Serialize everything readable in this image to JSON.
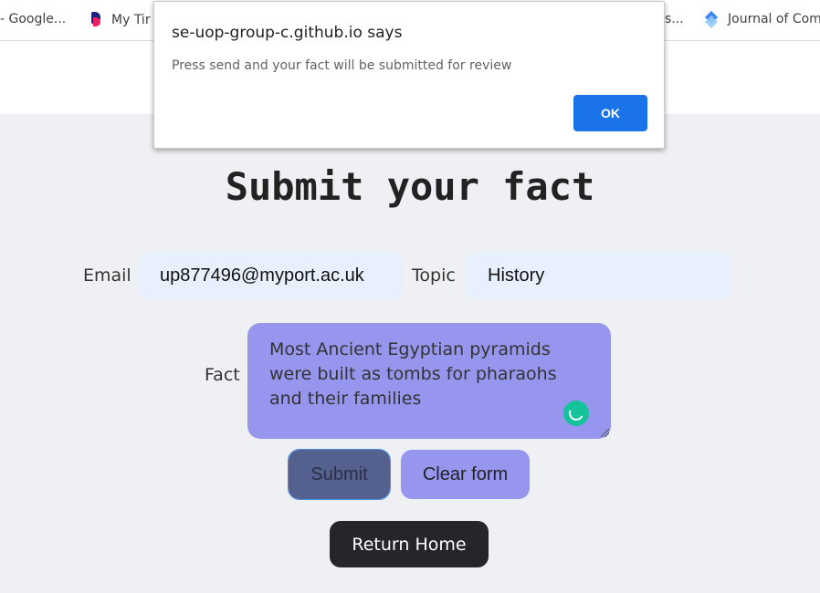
{
  "bookmarks": {
    "items": [
      {
        "label": "- Google...",
        "icon": "bookmark-icon"
      },
      {
        "label": "My Tir",
        "icon": "feedback-app-icon"
      },
      {
        "label": "s...",
        "icon": "none"
      },
      {
        "label": "Journal of Com",
        "icon": "journal-icon"
      }
    ]
  },
  "page": {
    "title": "Submit your fact",
    "form": {
      "email_label": "Email",
      "email_value": "up877496@myport.ac.uk",
      "topic_label": "Topic",
      "topic_value": "History",
      "fact_label": "Fact",
      "fact_value": "Most Ancient Egyptian pyramids were built as tombs for pharaohs and their families",
      "submit_label": "Submit",
      "clear_label": "Clear form"
    },
    "return_home_label": "Return Home"
  },
  "dialog": {
    "title": "se-uop-group-c.github.io says",
    "message": "Press send and your fact will be submitted for review",
    "ok_label": "OK"
  },
  "colors": {
    "ok_button": "#1a73e8",
    "fact_field": "#9696ef",
    "submit_button": "#54608e",
    "home_button": "#25262c",
    "input_background": "#e8effd"
  }
}
